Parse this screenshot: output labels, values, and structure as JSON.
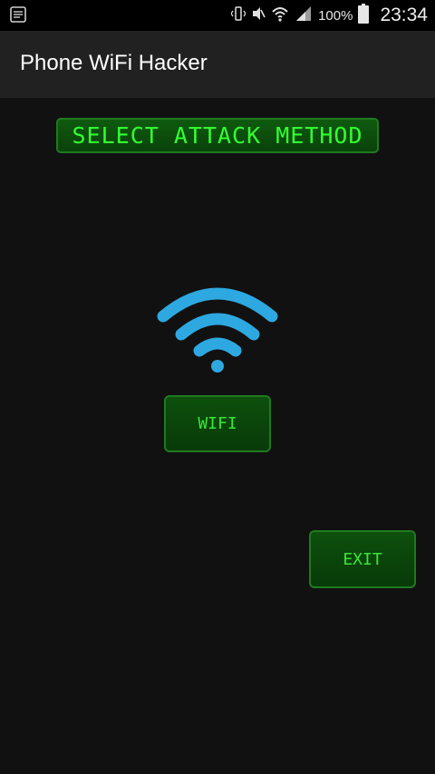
{
  "status_bar": {
    "battery_text": "100%",
    "time": "23:34",
    "icons": [
      "notes-icon",
      "vibrate-icon",
      "mute-icon",
      "wifi-status-icon",
      "signal-icon",
      "battery-icon"
    ]
  },
  "app_bar": {
    "title": "Phone WiFi Hacker"
  },
  "main": {
    "heading": "SELECT ATTACK METHOD",
    "wifi_button_label": "WIFI",
    "exit_button_label": "EXIT",
    "wifi_graphic_icon": "wifi-icon"
  },
  "colors": {
    "background": "#111111",
    "app_bar": "#212121",
    "green_text": "#33ff33",
    "button_green": "#0d500d",
    "wifi_blue": "#2ea8e0"
  }
}
